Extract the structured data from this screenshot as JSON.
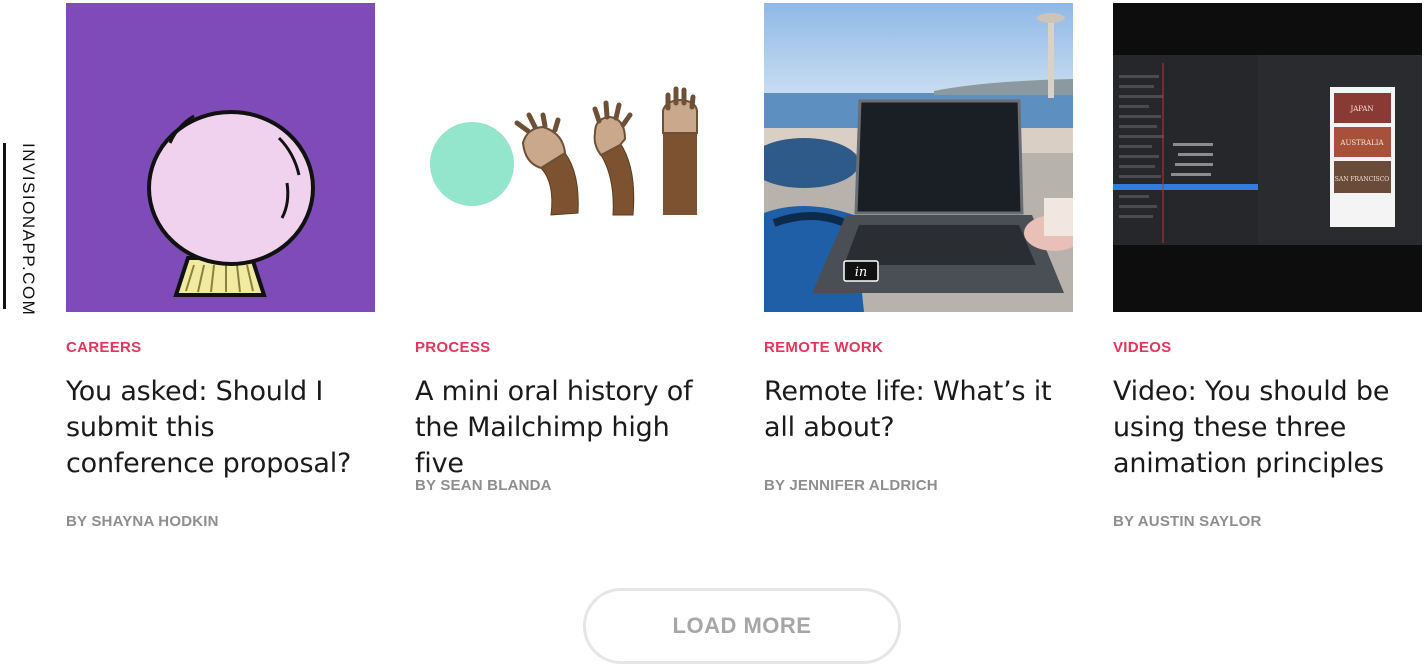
{
  "site": {
    "label": "INVISIONAPP.COM"
  },
  "cards": [
    {
      "category": "CAREERS",
      "title": "You asked: Should I submit this conference proposal?",
      "author": "BY SHAYNA HODKIN",
      "image_icon": "crystal-ball-illustration"
    },
    {
      "category": "PROCESS",
      "title": "A mini oral history of the Mailchimp high five",
      "author": "BY SEAN BLANDA",
      "image_icon": "high-five-illustration"
    },
    {
      "category": "REMOTE WORK",
      "title": "Remote life: What’s it all about?",
      "author": "BY JENNIFER ALDRICH",
      "image_icon": "laptop-beach-photo"
    },
    {
      "category": "VIDEOS",
      "title": "Video: You should be using these three animation principles",
      "author": "BY AUSTIN SAYLOR",
      "image_icon": "animation-software-screenshot",
      "thumb_labels": [
        "JAPAN",
        "AUSTRALIA",
        "SAN FRANCISCO"
      ]
    }
  ],
  "load_more": {
    "label": "LOAD MORE"
  },
  "colors": {
    "accent": "#e8345a",
    "careers_bg": "#7f4bb8",
    "title": "#1a1a1a",
    "author": "#8e8e8e"
  }
}
